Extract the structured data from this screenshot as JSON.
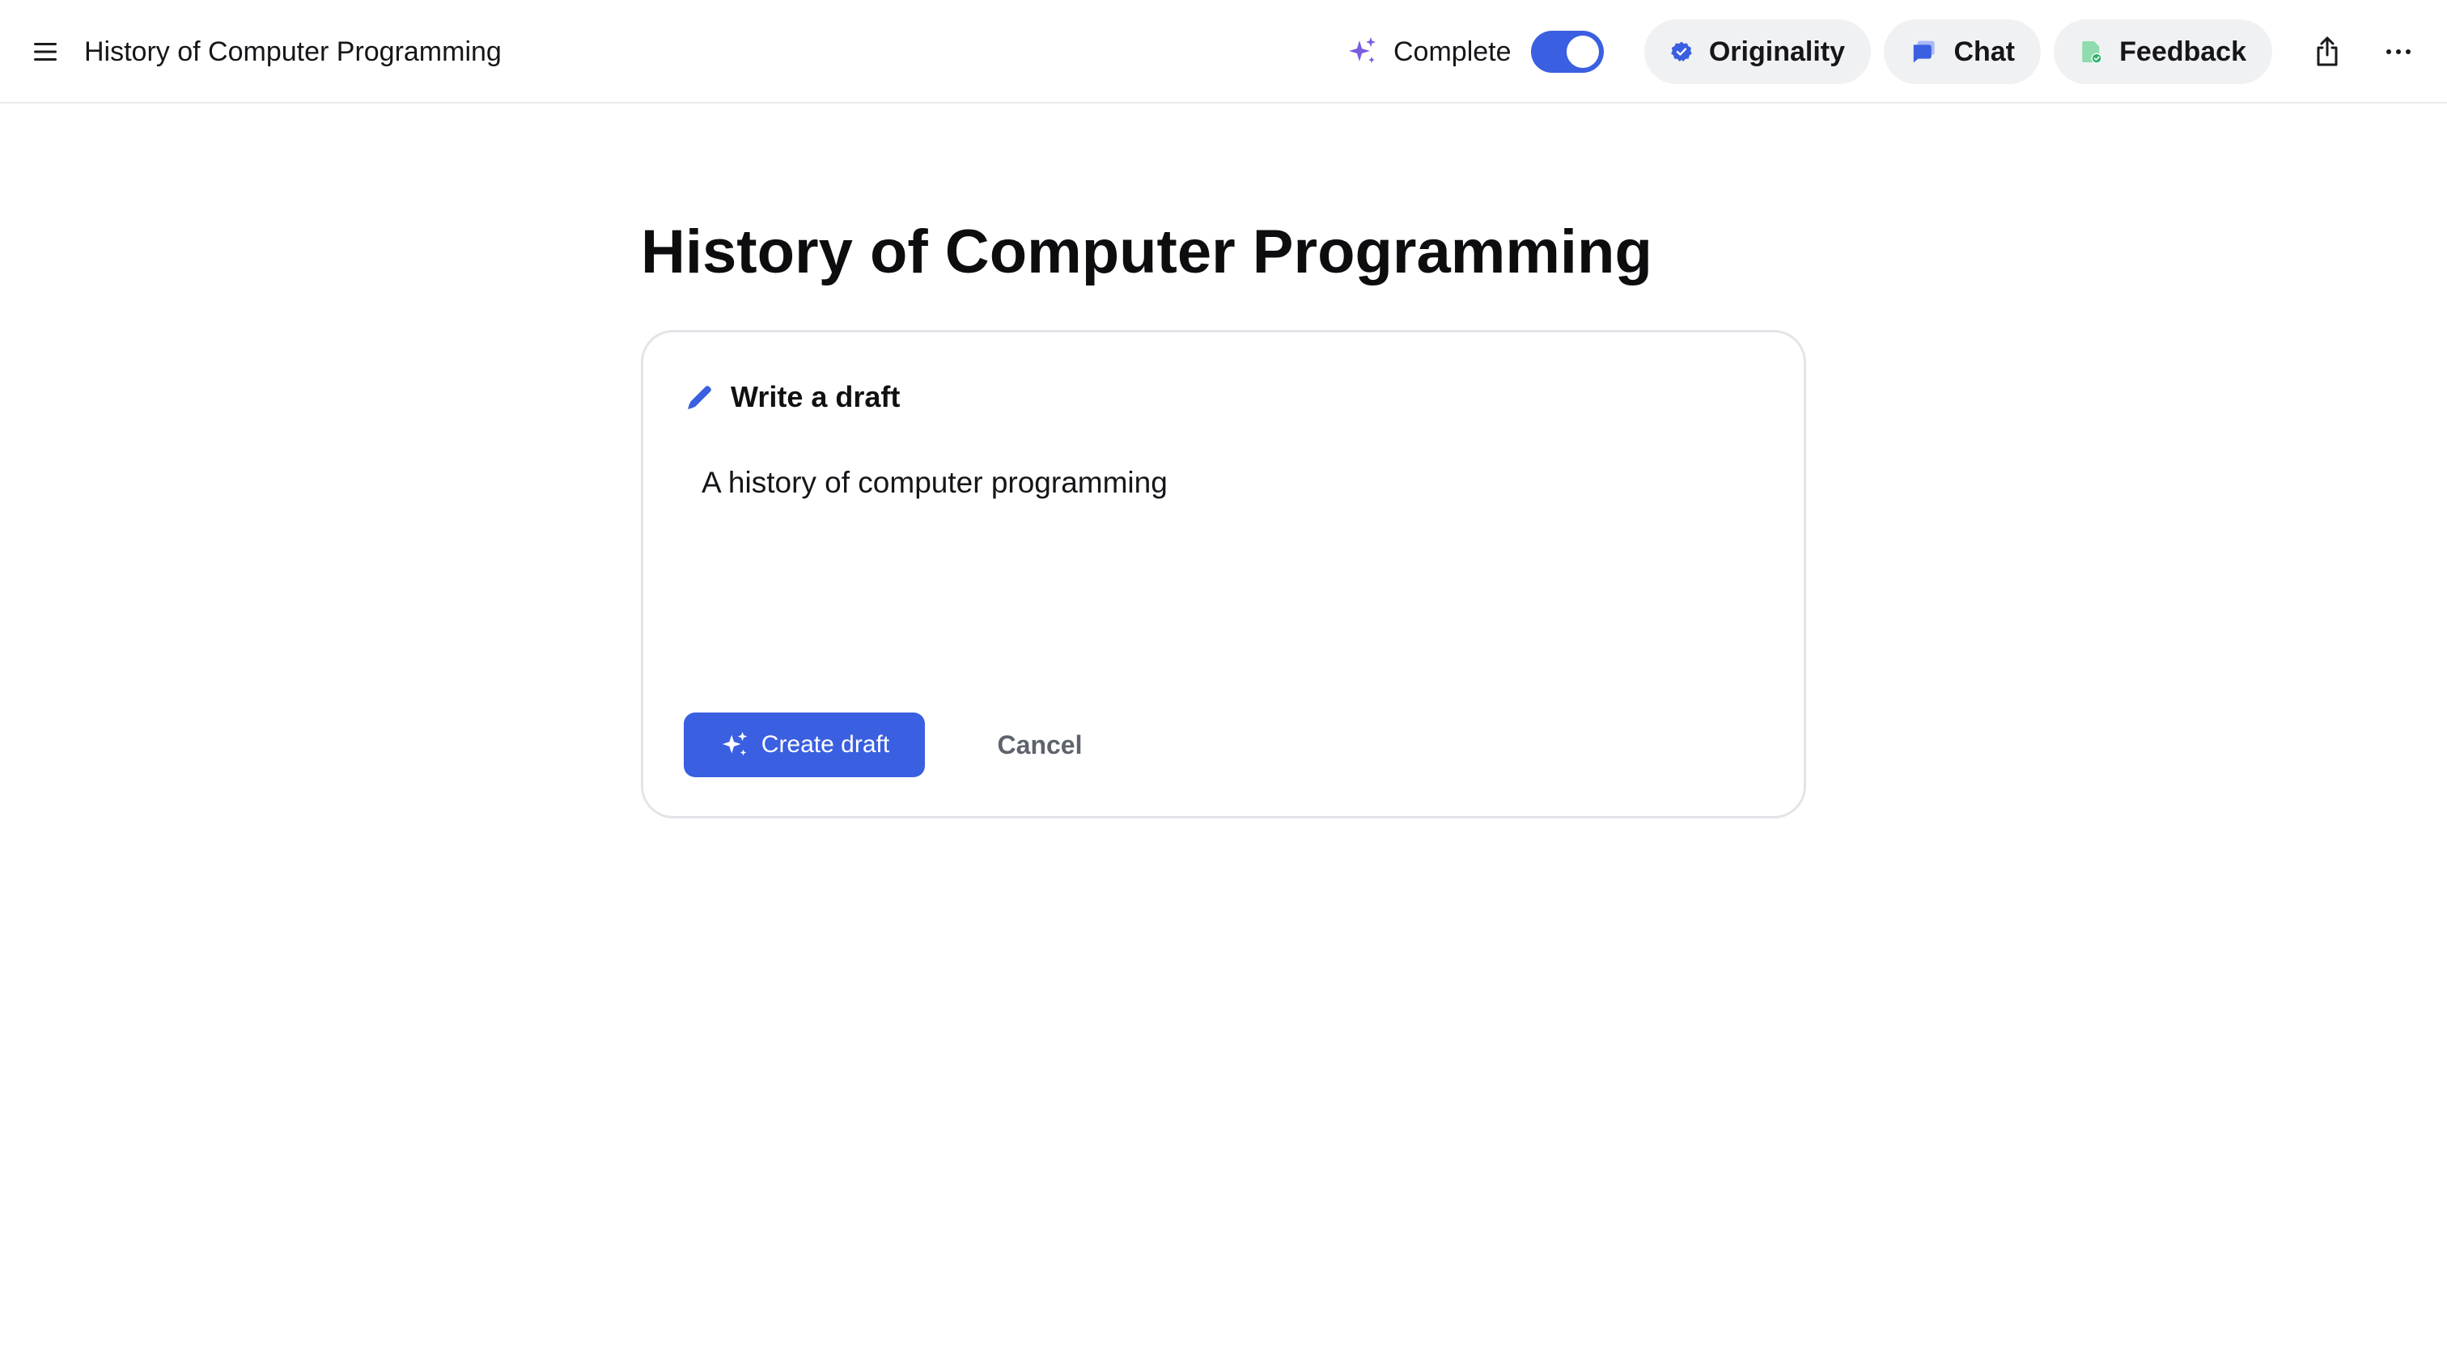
{
  "topbar": {
    "menu_icon": "hamburger-menu-icon",
    "document_title": "History of Computer Programming",
    "complete": {
      "icon": "sparkle-icon",
      "label": "Complete",
      "toggle_on": true,
      "toggle_color": "#3a5fe0"
    },
    "originality": {
      "icon": "verified-badge-icon",
      "label": "Originality"
    },
    "chat": {
      "icon": "chat-bubble-icon",
      "label": "Chat"
    },
    "feedback": {
      "icon": "feedback-document-icon",
      "label": "Feedback"
    },
    "share_icon": "share-icon",
    "more_icon": "more-horizontal-icon"
  },
  "main": {
    "page_title": "History of Computer Programming",
    "draft_card": {
      "icon": "pencil-icon",
      "header_label": "Write a draft",
      "prompt_value": "A history of computer programming",
      "create_button": {
        "icon": "sparkle-icon",
        "label": "Create draft"
      },
      "cancel_button": {
        "label": "Cancel"
      }
    }
  },
  "colors": {
    "accent": "#3a5fe0",
    "sparkle_purple": "#7b5ce0",
    "feedback_green": "#3ec27a",
    "pill_background": "#f0f1f3"
  }
}
